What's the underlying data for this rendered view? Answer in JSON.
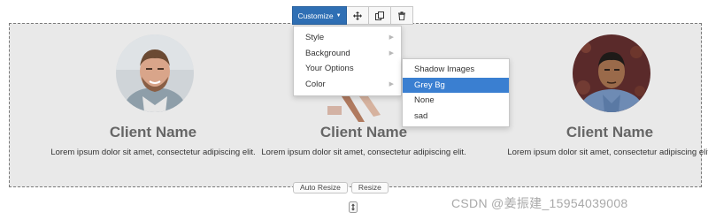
{
  "toolbar": {
    "customize_label": "Customize",
    "move_icon": "move-icon",
    "copy_icon": "copy-icon",
    "delete_icon": "trash-icon",
    "accent": "#2f6fb4"
  },
  "menu": {
    "items": [
      {
        "label": "Style",
        "has_submenu": true
      },
      {
        "label": "Background",
        "has_submenu": true
      },
      {
        "label": "Your Options",
        "has_submenu": false
      },
      {
        "label": "Color",
        "has_submenu": true
      }
    ]
  },
  "submenu": {
    "items": [
      {
        "label": "Shadow Images",
        "selected": false
      },
      {
        "label": "Grey Bg",
        "selected": true
      },
      {
        "label": "None",
        "selected": false
      },
      {
        "label": "sad",
        "selected": false
      }
    ],
    "selected_color": "#3a7fd1"
  },
  "cards": [
    {
      "name": "Client Name",
      "body": "Lorem ipsum dolor sit amet, consectetur adipiscing elit."
    },
    {
      "name": "Client Name",
      "body": "Lorem ipsum dolor sit amet, consectetur adipiscing elit."
    },
    {
      "name": "Client Name",
      "body": "Lorem ipsum dolor sit amet, consectetur adipiscing elit."
    }
  ],
  "resize": {
    "auto_label": "Auto Resize",
    "resize_label": "Resize"
  },
  "watermark": "CSDN @姜振建_15954039008",
  "section_bg": "#e9e9e9"
}
